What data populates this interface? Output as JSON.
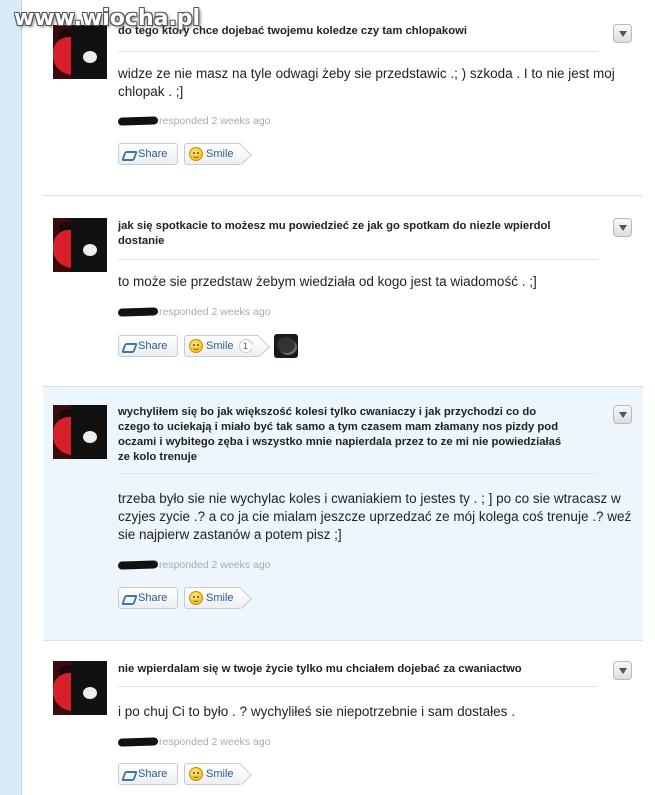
{
  "watermark": "www.wiocha.pl",
  "labels": {
    "share": "Share",
    "smile": "Smile"
  },
  "posts": [
    {
      "question": "do tego ktory chce dojebać twojemu koledze czy tam chlopakowi",
      "answer": "widze ze nie masz na tyle odwagi żeby sie przedstawic .; ) szkoda . I to nie jest moj chlopak . ;]",
      "meta": "responded 2 weeks ago",
      "smile_count": null
    },
    {
      "question": "jak się spotkacie to możesz mu powiedzieć ze jak go spotkam do niezle wpierdol dostanie",
      "answer": "to może sie przedstaw żebym wiedziała od kogo jest ta wiadomość . ;]",
      "meta": "responded 2 weeks ago",
      "smile_count": "1"
    },
    {
      "question": "wychyliłem się bo jak większość kolesi tylko cwaniaczy i jak przychodzi co do czego to uciekają i miało być tak samo a tym czasem mam złamany nos pizdy pod oczami i wybitego zęba i wszystko mnie napierdala przez to ze mi nie powiedziałaś ze kolo trenuje",
      "answer": "trzeba było sie nie wychylac koles i cwaniakiem to jestes ty . ; ] po co sie wtracasz w czyjes zycie .? a co ja cie mialam jeszcze uprzedzać ze mój kolega coś trenuje .? weź sie najpierw zastanów a potem pisz ;]",
      "meta": "responded 2 weeks ago",
      "smile_count": null
    },
    {
      "question": "nie wpierdalam się w twoje życie tylko mu chciałem dojebać za cwaniactwo",
      "answer": "i po chuj Ci to było . ? wychyliłeś sie niepotrzebnie i sam dostałes .",
      "meta": "responded 2 weeks ago",
      "smile_count": null
    }
  ]
}
